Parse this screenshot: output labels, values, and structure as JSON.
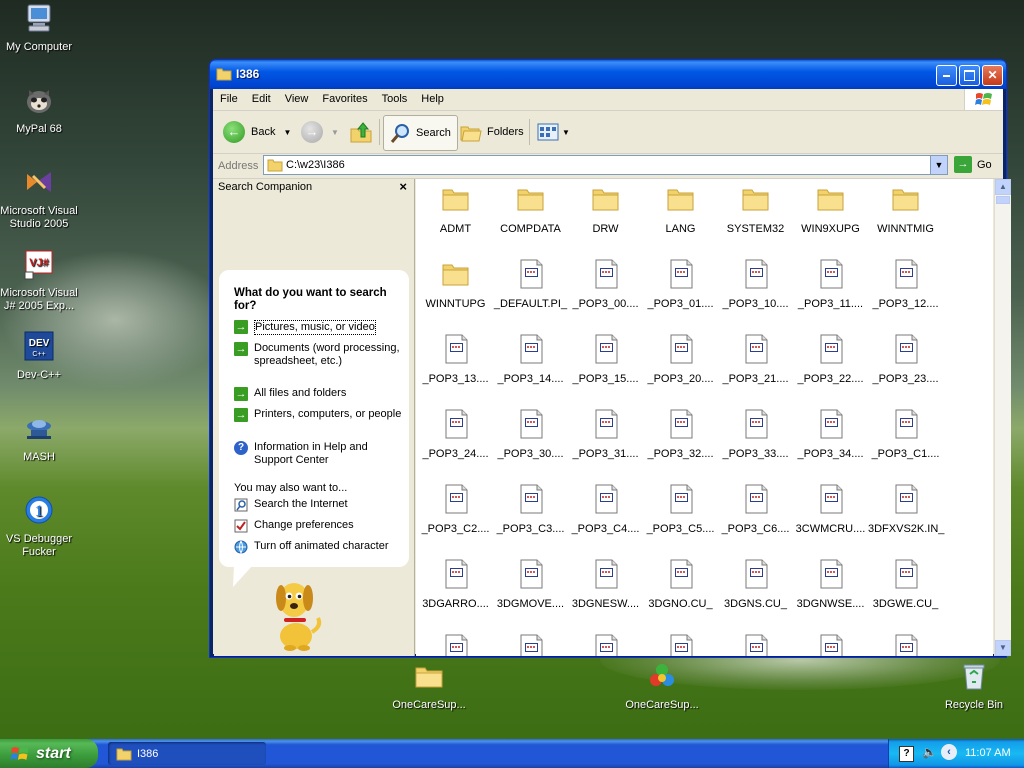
{
  "desktop": {
    "icons": [
      {
        "label": "My Computer"
      },
      {
        "label": "MyPal 68"
      },
      {
        "label": "Microsoft Visual Studio 2005"
      },
      {
        "label": "Microsoft Visual J# 2005 Exp..."
      },
      {
        "label": "Dev-C++"
      },
      {
        "label": "MASH"
      },
      {
        "label": "VS Debugger Fucker"
      },
      {
        "label": "OneCareSup..."
      },
      {
        "label": "OneCareSup..."
      },
      {
        "label": "Recycle Bin"
      }
    ]
  },
  "window": {
    "title": "I386",
    "menu": [
      "File",
      "Edit",
      "View",
      "Favorites",
      "Tools",
      "Help"
    ],
    "toolbar": {
      "back": "Back",
      "search": "Search",
      "folders": "Folders"
    },
    "address": {
      "label": "Address",
      "value": "C:\\w23\\I386",
      "go": "Go"
    }
  },
  "search_companion": {
    "header": "Search Companion",
    "close": "×",
    "question": "What do you want to search for?",
    "options": [
      "Pictures, music, or video",
      "Documents (word processing, spreadsheet, etc.)",
      "All files and folders",
      "Printers, computers, or people",
      "Information in Help and Support Center"
    ],
    "also_label": "You may also want to...",
    "also": [
      "Search the Internet",
      "Change preferences",
      "Turn off animated character"
    ]
  },
  "files": [
    {
      "name": "ADMT",
      "type": "folder"
    },
    {
      "name": "COMPDATA",
      "type": "folder"
    },
    {
      "name": "DRW",
      "type": "folder"
    },
    {
      "name": "LANG",
      "type": "folder"
    },
    {
      "name": "SYSTEM32",
      "type": "folder"
    },
    {
      "name": "WIN9XUPG",
      "type": "folder"
    },
    {
      "name": "WINNTMIG",
      "type": "folder"
    },
    {
      "name": "WINNTUPG",
      "type": "folder"
    },
    {
      "name": "_DEFAULT.PI_",
      "type": "file"
    },
    {
      "name": "_POP3_00....",
      "type": "file"
    },
    {
      "name": "_POP3_01....",
      "type": "file"
    },
    {
      "name": "_POP3_10....",
      "type": "file"
    },
    {
      "name": "_POP3_11....",
      "type": "file"
    },
    {
      "name": "_POP3_12....",
      "type": "file"
    },
    {
      "name": "_POP3_13....",
      "type": "file"
    },
    {
      "name": "_POP3_14....",
      "type": "file"
    },
    {
      "name": "_POP3_15....",
      "type": "file"
    },
    {
      "name": "_POP3_20....",
      "type": "file"
    },
    {
      "name": "_POP3_21....",
      "type": "file"
    },
    {
      "name": "_POP3_22....",
      "type": "file"
    },
    {
      "name": "_POP3_23....",
      "type": "file"
    },
    {
      "name": "_POP3_24....",
      "type": "file"
    },
    {
      "name": "_POP3_30....",
      "type": "file"
    },
    {
      "name": "_POP3_31....",
      "type": "file"
    },
    {
      "name": "_POP3_32....",
      "type": "file"
    },
    {
      "name": "_POP3_33....",
      "type": "file"
    },
    {
      "name": "_POP3_34....",
      "type": "file"
    },
    {
      "name": "_POP3_C1....",
      "type": "file"
    },
    {
      "name": "_POP3_C2....",
      "type": "file"
    },
    {
      "name": "_POP3_C3....",
      "type": "file"
    },
    {
      "name": "_POP3_C4....",
      "type": "file"
    },
    {
      "name": "_POP3_C5....",
      "type": "file"
    },
    {
      "name": "_POP3_C6....",
      "type": "file"
    },
    {
      "name": "3CWMCRU....",
      "type": "file"
    },
    {
      "name": "3DFXVS2K.IN_",
      "type": "file"
    },
    {
      "name": "3DGARRO....",
      "type": "file"
    },
    {
      "name": "3DGMOVE....",
      "type": "file"
    },
    {
      "name": "3DGNESW....",
      "type": "file"
    },
    {
      "name": "3DGNO.CU_",
      "type": "file"
    },
    {
      "name": "3DGNS.CU_",
      "type": "file"
    },
    {
      "name": "3DGNWSE....",
      "type": "file"
    },
    {
      "name": "3DGWE.CU_",
      "type": "file"
    },
    {
      "name": "",
      "type": "file"
    },
    {
      "name": "",
      "type": "file"
    },
    {
      "name": "",
      "type": "file"
    },
    {
      "name": "",
      "type": "file"
    },
    {
      "name": "",
      "type": "file"
    },
    {
      "name": "",
      "type": "file"
    },
    {
      "name": "",
      "type": "file"
    }
  ],
  "taskbar": {
    "start": "start",
    "task": "I386",
    "clock": "11:07 AM"
  }
}
